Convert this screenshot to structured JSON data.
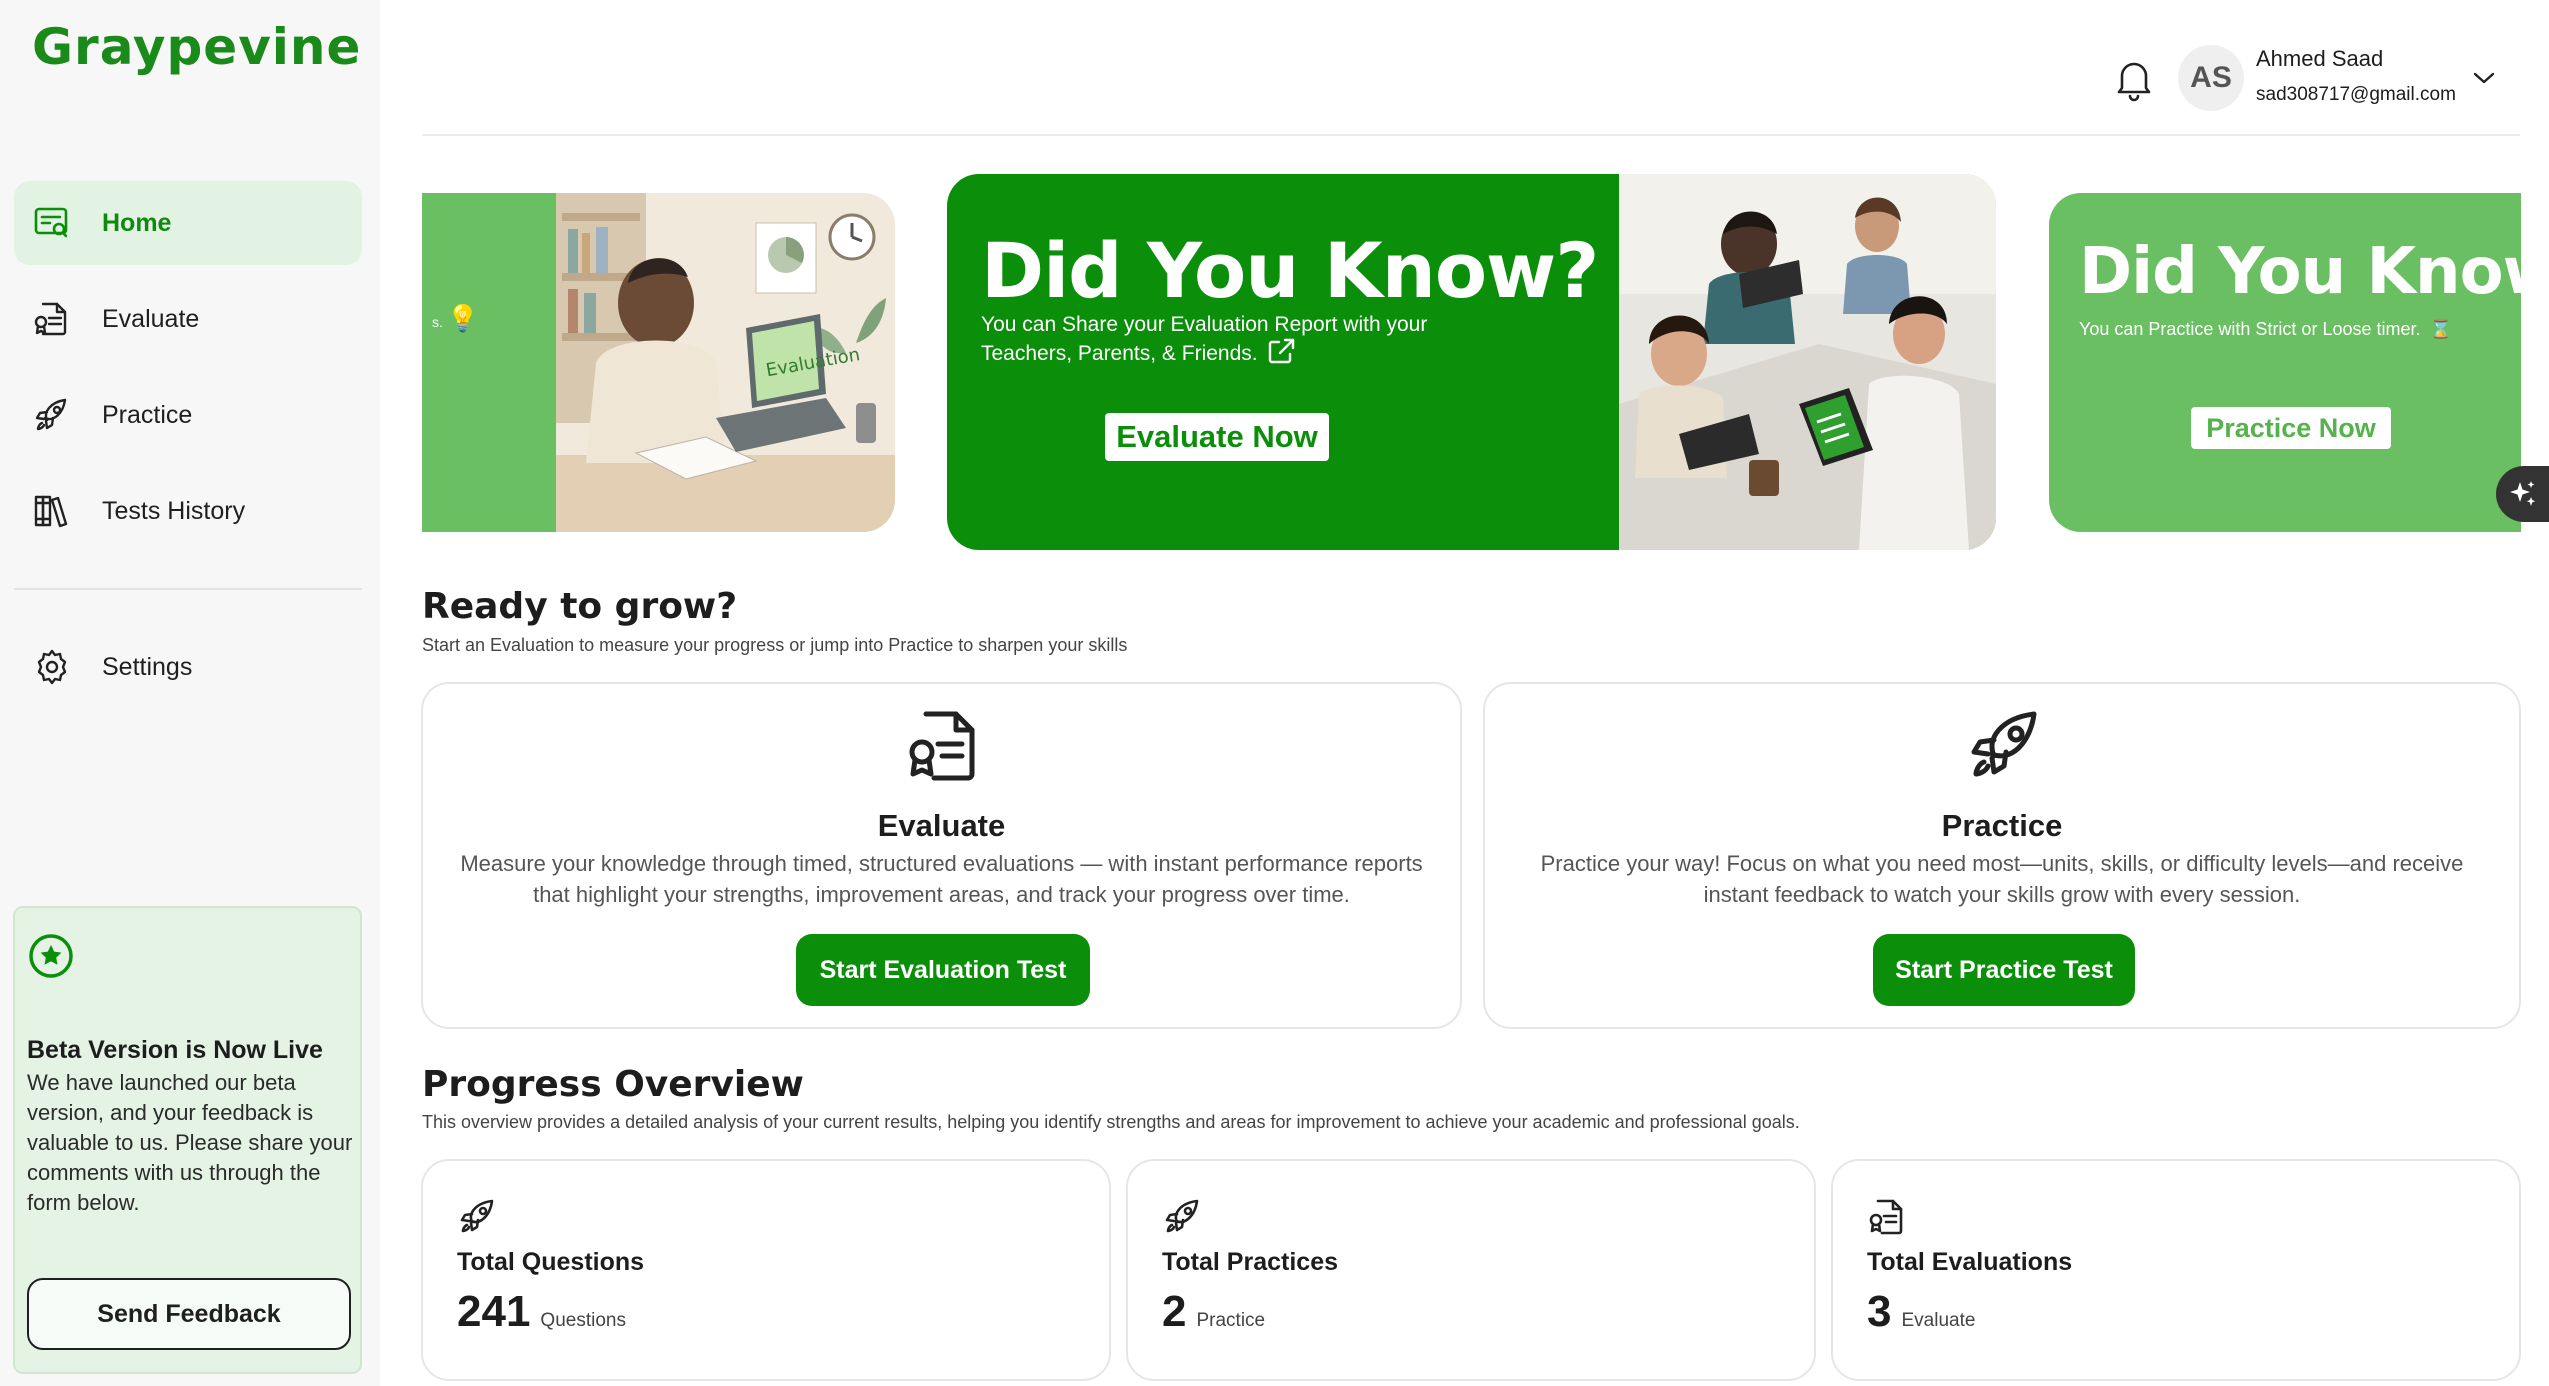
{
  "app": {
    "name": "Graypevine"
  },
  "sidebar": {
    "items": [
      {
        "label": "Home",
        "icon": "home-report-icon",
        "active": true
      },
      {
        "label": "Evaluate",
        "icon": "evaluate-doc-icon",
        "active": false
      },
      {
        "label": "Practice",
        "icon": "rocket-icon",
        "active": false
      },
      {
        "label": "Tests History",
        "icon": "books-icon",
        "active": false
      }
    ],
    "settings_label": "Settings",
    "beta": {
      "title": "Beta Version is Now Live",
      "text": "We have launched our beta version, and your feedback is valuable to us. Please share your comments with us through the form below.",
      "button": "Send Feedback"
    }
  },
  "header": {
    "user_initials": "AS",
    "user_name": "Ahmed Saad",
    "user_email": "sad308717@gmail.com"
  },
  "banners": {
    "left": {
      "illustration_text": "Evaluation"
    },
    "main": {
      "title": "Did You Know?",
      "text": "You can Share your Evaluation Report with your Teachers, Parents, & Friends.",
      "button": "Evaluate Now"
    },
    "right": {
      "title": "Did You Know?",
      "text": "You can Practice with Strict or Loose timer.",
      "button": "Practice Now"
    }
  },
  "ready": {
    "title": "Ready to grow?",
    "subtitle": "Start an Evaluation to measure your progress or jump into Practice to sharpen your skills",
    "evaluate": {
      "title": "Evaluate",
      "text": "Measure your knowledge through timed, structured evaluations — with instant performance reports that highlight your strengths, improvement areas, and track your progress over time.",
      "button": "Start Evaluation Test"
    },
    "practice": {
      "title": "Practice",
      "text": "Practice your way! Focus on what you need most—units, skills, or difficulty levels—and receive instant feedback to watch your skills grow with every session.",
      "button": "Start Practice Test"
    }
  },
  "progress": {
    "title": "Progress Overview",
    "subtitle": "This overview provides a detailed analysis of your current results, helping you identify strengths and areas for improvement to achieve your academic and professional goals.",
    "stats": [
      {
        "label": "Total Questions",
        "value": "241",
        "unit": "Questions"
      },
      {
        "label": "Total Practices",
        "value": "2",
        "unit": "Practice"
      },
      {
        "label": "Total Evaluations",
        "value": "3",
        "unit": "Evaluate"
      }
    ]
  },
  "colors": {
    "brand": "#0b8f0b",
    "brand_light": "#6abf62",
    "active_bg": "#e3f3e3"
  }
}
